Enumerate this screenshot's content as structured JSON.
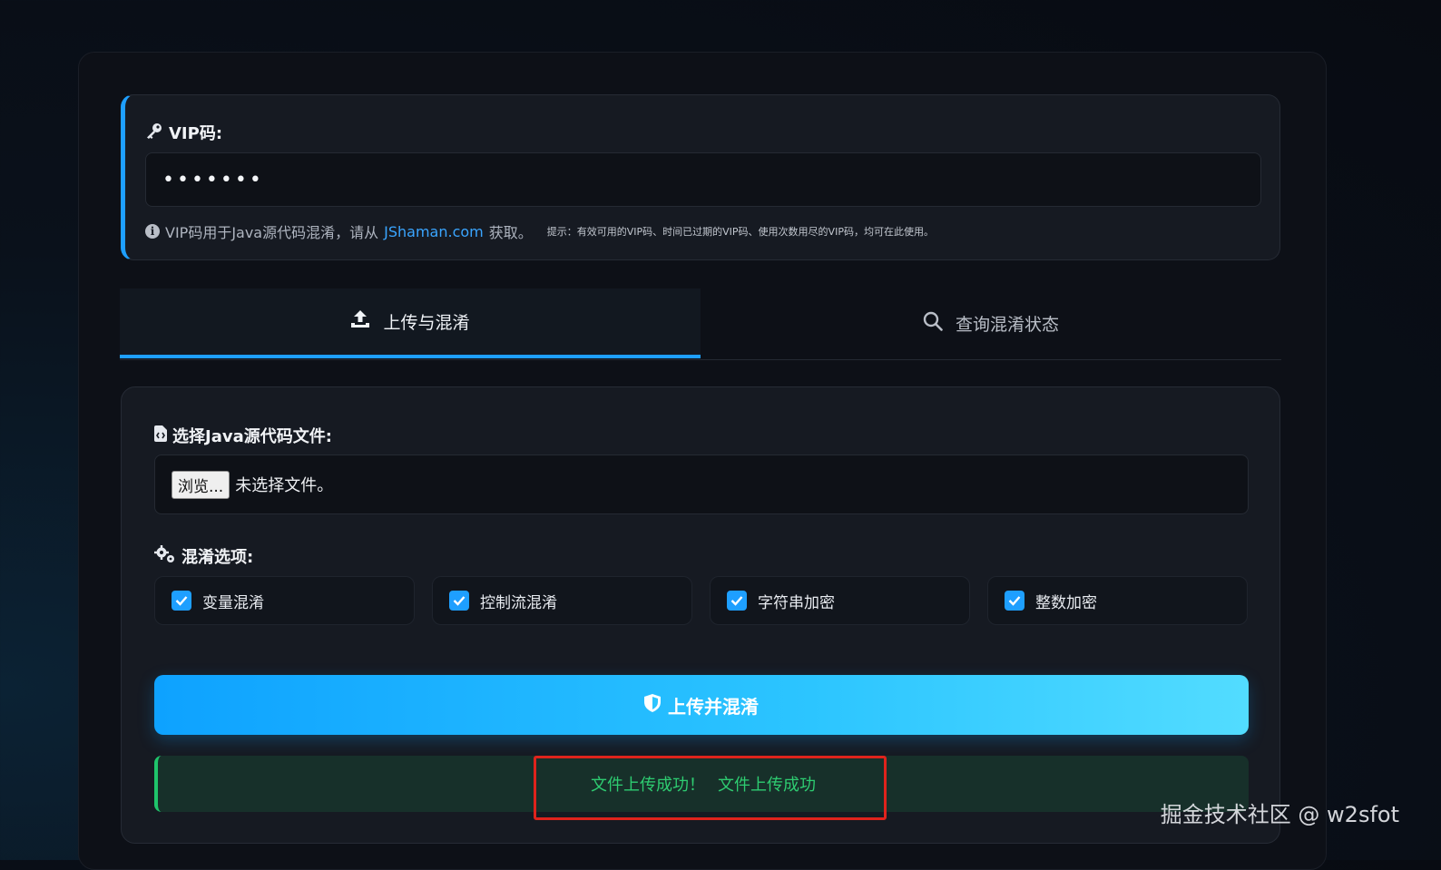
{
  "vip": {
    "label": "VIP码:",
    "value": "•••••••",
    "hint_prefix": "VIP码用于Java源代码混淆，请从",
    "hint_link": "JShaman.com",
    "hint_suffix": "获取。",
    "hint_small": "提示：有效可用的VIP码、时间已过期的VIP码、使用次数用尽的VIP码，均可在此使用。"
  },
  "tabs": [
    {
      "label": "上传与混淆",
      "icon": "upload-icon",
      "active": true
    },
    {
      "label": "查询混淆状态",
      "icon": "search-icon",
      "active": false
    }
  ],
  "upload": {
    "file_label": "选择Java源代码文件:",
    "browse_label": "浏览...",
    "file_status": "未选择文件。",
    "options_label": "混淆选项:",
    "options": [
      {
        "label": "变量混淆",
        "checked": true
      },
      {
        "label": "控制流混淆",
        "checked": true
      },
      {
        "label": "字符串加密",
        "checked": true
      },
      {
        "label": "整数加密",
        "checked": true
      }
    ],
    "submit_label": "上传并混淆",
    "success_part1": "文件上传成功！",
    "success_part2": "文件上传成功"
  },
  "watermark": "掘金技术社区 @ w2sfot",
  "colors": {
    "accent": "#1e9fff",
    "success": "#2ecc71",
    "highlight_box": "#e0231c"
  }
}
